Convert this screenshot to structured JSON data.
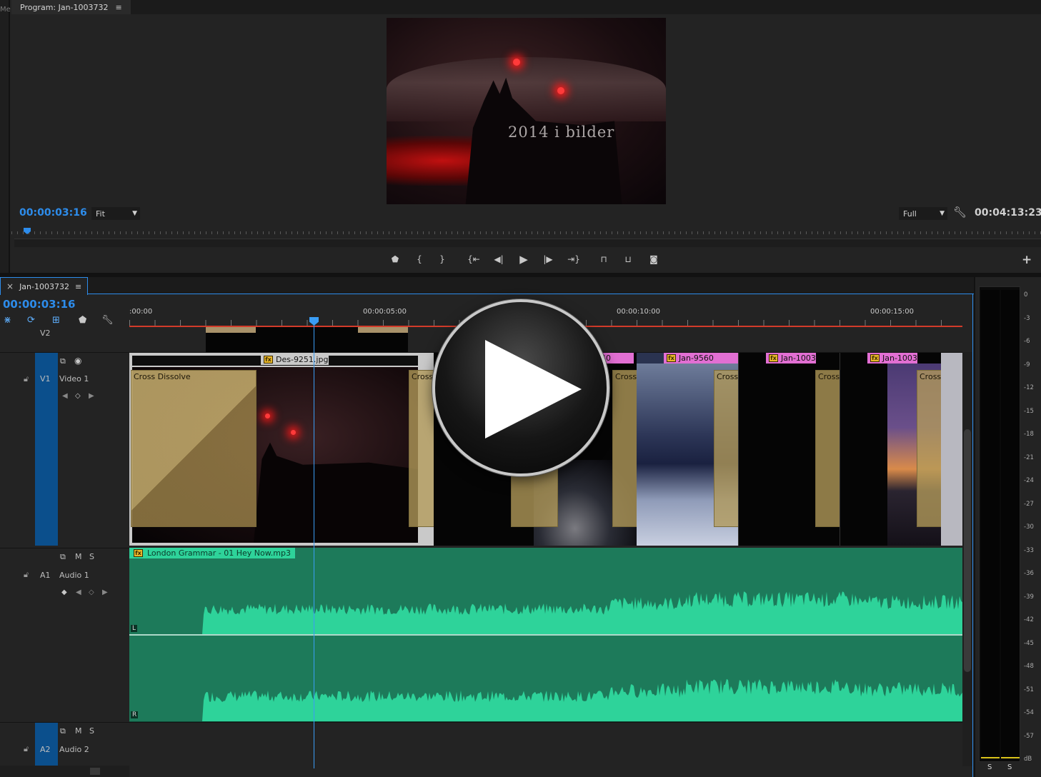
{
  "program_monitor": {
    "left_panel_fragment": "Me",
    "tab_title": "Program: Jan-1003732",
    "tab_menu_icon": "hamburger-icon",
    "preview_caption": "2014 i bilder",
    "current_time": "00:00:03:16",
    "zoom_select": "Fit",
    "resolution_select": "Full",
    "settings_icon": "wrench-icon",
    "duration": "00:04:13:23",
    "transport_icons": [
      "marker-icon",
      "mark-in-icon",
      "mark-out-icon",
      "go-to-in-icon",
      "step-back-icon",
      "play-icon",
      "step-forward-icon",
      "go-to-out-icon",
      "lift-icon",
      "extract-icon",
      "export-frame-icon"
    ],
    "transport_glyphs": [
      "⬟",
      "{",
      "}",
      "{⇤",
      "◀|",
      "▶",
      "|▶",
      "⇥}",
      "⊓",
      "⊔",
      "◙"
    ],
    "button_editor_label": "+"
  },
  "timeline": {
    "close_glyph": "×",
    "tab_title": "Jan-1003732",
    "current_time": "00:00:03:16",
    "ruler_labels": [
      ":00:00",
      "00:00:05:00",
      "00:00:10:00",
      "00:00:15:00"
    ],
    "tracks": {
      "v2": {
        "name": "V2"
      },
      "v1": {
        "chip": "V1",
        "name": "Video 1"
      },
      "a1": {
        "chip": "A1",
        "name": "Audio 1",
        "mute": "M",
        "solo": "S"
      },
      "a2": {
        "chip": "A2",
        "name": "Audio 2",
        "mute": "M",
        "solo": "S"
      }
    },
    "video_clips": [
      {
        "name": "Des-9251.jpg",
        "label_color": "#c9c9c9"
      },
      {
        "name": "Jan-9560",
        "label_color": "#e26fd3"
      },
      {
        "name": "Jan-1003",
        "label_color": "#e26fd3"
      },
      {
        "name": "Jan-1003",
        "label_color": "#e26fd3"
      }
    ],
    "transitions": [
      "Cross Dissolve",
      "Cross",
      "Cross Dissol",
      "Cross Dissol",
      "Cross Dissol",
      "Cross Disso"
    ],
    "partial_clip_label": "40",
    "audio_clip": {
      "name": "London Grammar - 01 Hey Now.mp3",
      "left_channel": "L",
      "right_channel": "R",
      "color": "#2ed39a"
    }
  },
  "audio_meter": {
    "scale": [
      "0",
      "-3",
      "-6",
      "-9",
      "-12",
      "-15",
      "-18",
      "-21",
      "-24",
      "-27",
      "-30",
      "-33",
      "-36",
      "-39",
      "-42",
      "-45",
      "-48",
      "-51",
      "-54",
      "-57",
      "dB"
    ],
    "solo_buttons": [
      "S",
      "S"
    ]
  },
  "overlay": {
    "play_icon": "big-play-icon"
  }
}
